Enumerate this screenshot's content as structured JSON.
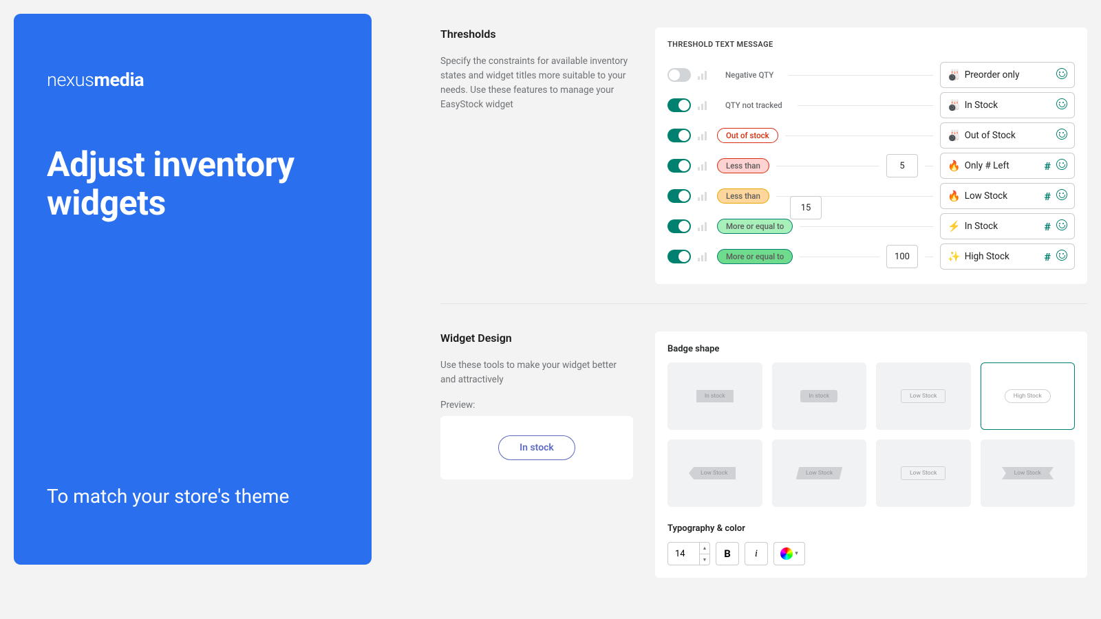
{
  "hero": {
    "brand_light": "nexus",
    "brand_bold": "media",
    "title": "Adjust inventory widgets",
    "subtitle": "To match your store's theme"
  },
  "thresholds": {
    "heading": "Thresholds",
    "desc": "Specify the constraints for available inventory states and widget titles more suitable to your needs. Use these features to manage your EasyStock widget",
    "card_title": "THRESHOLD TEXT MESSAGE",
    "rows": [
      {
        "on": false,
        "tag": "Negative QTY",
        "tag_style": "plain",
        "num": "",
        "emoji": "🎳",
        "msg": "Preorder only",
        "hash": false,
        "face": "blue"
      },
      {
        "on": true,
        "tag": "QTY not tracked",
        "tag_style": "plain",
        "num": "",
        "emoji": "🎳",
        "msg": "In Stock",
        "hash": false,
        "face": "blue"
      },
      {
        "on": true,
        "tag": "Out of stock",
        "tag_style": "outline-red",
        "num": "",
        "emoji": "🎳",
        "msg": "Out of Stock",
        "hash": false,
        "face": "green"
      },
      {
        "on": true,
        "tag": "Less than",
        "tag_style": "fill-red",
        "num": "5",
        "emoji": "🔥",
        "msg": "Only # Left",
        "hash": true,
        "face": "green"
      },
      {
        "on": true,
        "tag": "Less than",
        "tag_style": "fill-yellow",
        "num": "",
        "emoji": "🔥",
        "msg": "Low Stock",
        "hash": true,
        "face": "green"
      },
      {
        "on": true,
        "tag": "More or equal to",
        "tag_style": "fill-teal",
        "num": "",
        "emoji": "⚡",
        "msg": "In Stock",
        "hash": true,
        "face": "green"
      },
      {
        "on": true,
        "tag": "More or equal to",
        "tag_style": "fill-green",
        "num": "100",
        "emoji": "✨",
        "msg": "High Stock",
        "hash": true,
        "face": "green"
      }
    ],
    "mid_num": "15"
  },
  "design": {
    "heading": "Widget Design",
    "desc": "Use these tools to make your widget better and attractively",
    "preview_label": "Preview:",
    "preview_text": "In stock",
    "badge_title": "Badge shape",
    "shapes": [
      {
        "label": "In stock",
        "style": "solid-sq",
        "selected": false
      },
      {
        "label": "In stock",
        "style": "solid",
        "selected": false
      },
      {
        "label": "Low Stock",
        "style": "outline",
        "selected": false
      },
      {
        "label": "High Stock",
        "style": "pill",
        "selected": true
      },
      {
        "label": "Low Stock",
        "style": "arrow",
        "selected": false
      },
      {
        "label": "Low Stock",
        "style": "skew",
        "selected": false
      },
      {
        "label": "Low Stock",
        "style": "outline",
        "selected": false
      },
      {
        "label": "Low Stock",
        "style": "ribbon",
        "selected": false
      }
    ],
    "typo_title": "Typography & color",
    "font_size": "14"
  }
}
